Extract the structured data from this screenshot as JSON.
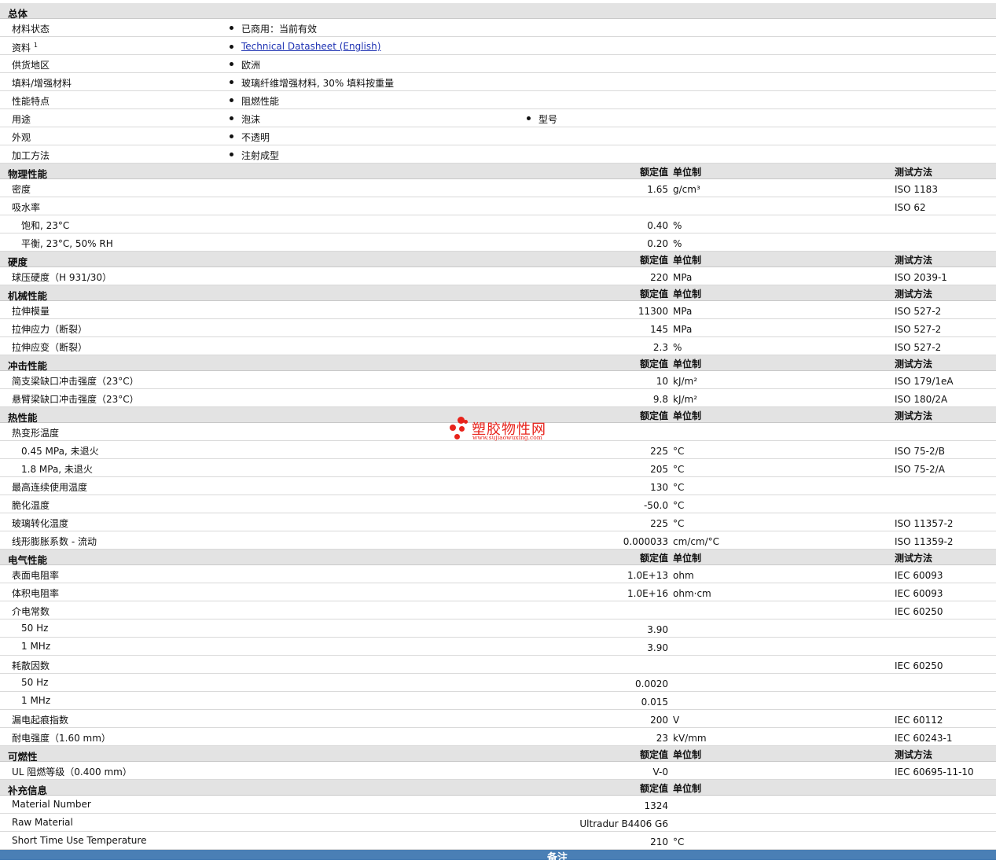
{
  "general": {
    "title": "总体",
    "status_label": "材料状态",
    "status_value": "已商用：当前有效",
    "docs_label": "资料",
    "docs_sup": "1",
    "docs_link": "Technical Datasheet (English)",
    "region_label": "供货地区",
    "region_value": "欧洲",
    "filler_label": "填料/增强材料",
    "filler_value": "玻璃纤维增强材料, 30% 填料按重量",
    "feature_label": "性能特点",
    "feature_value": "阻燃性能",
    "use_label": "用途",
    "use_value1": "泡沫",
    "use_value2": "型号",
    "appearance_label": "外观",
    "appearance_value": "不透明",
    "process_label": "加工方法",
    "process_value": "注射成型"
  },
  "headers": {
    "rated": "额定值",
    "unit": "单位制",
    "method": "测试方法"
  },
  "sections": {
    "physical": "物理性能",
    "hardness": "硬度",
    "mechanical": "机械性能",
    "impact": "冲击性能",
    "thermal": "热性能",
    "electrical": "电气性能",
    "flammability": "可燃性",
    "supplementary": "补充信息"
  },
  "rows": {
    "density": [
      "密度",
      "1.65",
      "g/cm³",
      "ISO 1183"
    ],
    "water": [
      "吸水率",
      "",
      "",
      "ISO 62"
    ],
    "water_sat": [
      "饱和, 23°C",
      "0.40",
      "%",
      ""
    ],
    "water_eq": [
      "平衡, 23°C, 50% RH",
      "0.20",
      "%",
      ""
    ],
    "ball": [
      "球压硬度（H 931/30）",
      "220",
      "MPa",
      "ISO 2039-1"
    ],
    "tmod": [
      "拉伸模量",
      "11300",
      "MPa",
      "ISO 527-2"
    ],
    "tstress": [
      "拉伸应力（断裂）",
      "145",
      "MPa",
      "ISO 527-2"
    ],
    "tstrain": [
      "拉伸应变（断裂）",
      "2.3",
      "%",
      "ISO 527-2"
    ],
    "charpy": [
      "简支梁缺口冲击强度（23°C）",
      "10",
      "kJ/m²",
      "ISO 179/1eA"
    ],
    "izod": [
      "悬臂梁缺口冲击强度（23°C）",
      "9.8",
      "kJ/m²",
      "ISO 180/2A"
    ],
    "hdt": [
      "热变形温度",
      "",
      "",
      ""
    ],
    "hdt1": [
      "0.45 MPa, 未退火",
      "225",
      "°C",
      "ISO 75-2/B"
    ],
    "hdt2": [
      "1.8 MPa, 未退火",
      "205",
      "°C",
      "ISO 75-2/A"
    ],
    "maxuse": [
      "最高连续使用温度",
      "130",
      "°C",
      ""
    ],
    "brittle": [
      "脆化温度",
      "-50.0",
      "°C",
      ""
    ],
    "tg": [
      "玻璃转化温度",
      "225",
      "°C",
      "ISO 11357-2"
    ],
    "clte": [
      "线形膨胀系数 - 流动",
      "0.000033",
      "cm/cm/°C",
      "ISO 11359-2"
    ],
    "surfres": [
      "表面电阻率",
      "1.0E+13",
      "ohm",
      "IEC 60093"
    ],
    "volres": [
      "体积电阻率",
      "1.0E+16",
      "ohm·cm",
      "IEC 60093"
    ],
    "dielec": [
      "介电常数",
      "",
      "",
      "IEC 60250"
    ],
    "dielec50": [
      "50 Hz",
      "3.90",
      "",
      ""
    ],
    "dielec1m": [
      "1 MHz",
      "3.90",
      "",
      ""
    ],
    "dissip": [
      "耗散因数",
      "",
      "",
      "IEC 60250"
    ],
    "dissip50": [
      "50 Hz",
      "0.0020",
      "",
      ""
    ],
    "dissip1m": [
      "1 MHz",
      "0.015",
      "",
      ""
    ],
    "cti": [
      "漏电起痕指数",
      "200",
      "V",
      "IEC 60112"
    ],
    "dstrength": [
      "耐电强度（1.60 mm）",
      "23",
      "kV/mm",
      "IEC 60243-1"
    ],
    "ul": [
      "UL 阻燃等级（0.400 mm）",
      "V-0",
      "",
      "IEC 60695-11-10"
    ],
    "matnum": [
      "Material Number",
      "1324",
      "",
      ""
    ],
    "raw": [
      "Raw Material",
      "Ultradur B4406 G6",
      "",
      ""
    ],
    "shorttime": [
      "Short Time Use Temperature",
      "210",
      "°C",
      ""
    ]
  },
  "watermark": {
    "text": "塑胶物性网",
    "url": "www.sujiaowuxing.com",
    "color": "#e8231b"
  },
  "footer": {
    "label": "备注",
    "color": "#4a7fb5"
  }
}
